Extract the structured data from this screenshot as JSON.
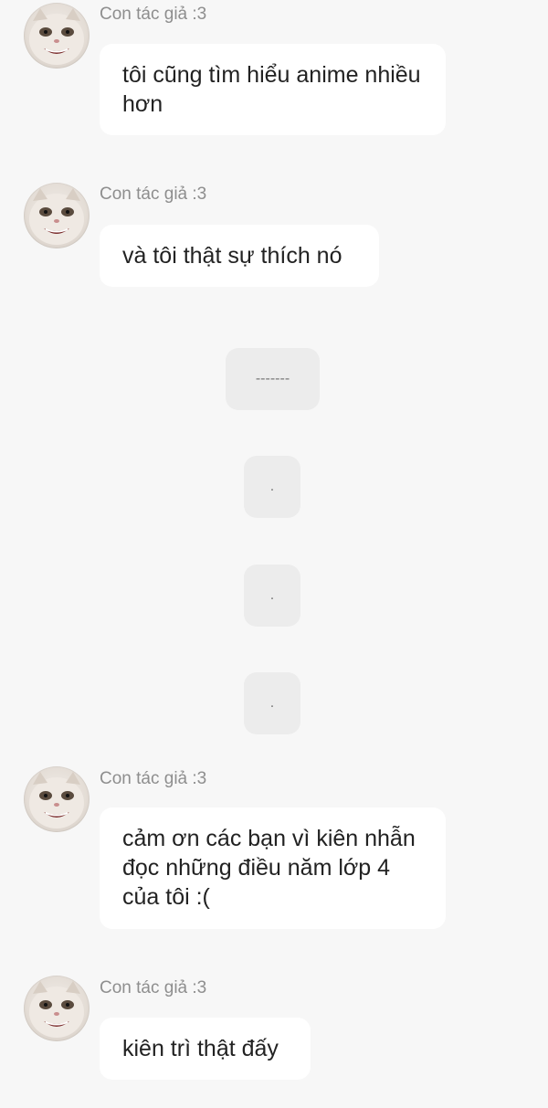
{
  "sender_name": "Con tác giả :3",
  "messages": [
    {
      "text": "tôi cũng tìm hiểu anime nhiều hơn"
    },
    {
      "text": "và tôi thật sự thích nó"
    },
    {
      "text": "cảm ơn các bạn vì kiên nhẫn đọc những điều năm lớp 4 của tôi :("
    },
    {
      "text": "kiên trì thật đấy"
    }
  ],
  "dividers": [
    {
      "text": "-------"
    },
    {
      "text": "."
    },
    {
      "text": "."
    },
    {
      "text": "."
    }
  ],
  "avatar_icon": "cat-face-icon"
}
